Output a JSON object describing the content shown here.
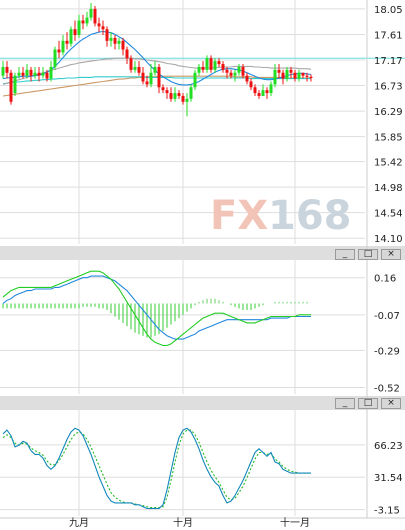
{
  "watermark": "FX168",
  "colors": {
    "up_candle": "#22dd22",
    "down_candle": "#ee1111",
    "ma_blue": "#2288dd",
    "ma_gray": "#a8a8a8",
    "ma_brown": "#cc9966",
    "ma_cyan": "#33cccc",
    "ref_line": "#66dddd",
    "macd_dif": "#22cc22",
    "macd_dea": "#2288dd",
    "kdj_k": "#1188bb",
    "kdj_d": "#22bb22",
    "grid": "#dddddd",
    "panel_bar": "#dedede",
    "watermark_fx": "#f2c4b8",
    "watermark_168": "#c9d4dd"
  },
  "panel_controls": {
    "minimize_icon": "_",
    "restore_icon": "□",
    "close_icon": "×"
  },
  "chart_data": [
    {
      "type": "candlestick",
      "title": "",
      "ylim": [
        14.0,
        18.1
      ],
      "yticks": [
        "18.05",
        "17.61",
        "17.17",
        "16.73",
        "16.29",
        "15.85",
        "15.42",
        "14.98",
        "14.54",
        "14.10"
      ],
      "reference_line": 17.2,
      "xticks": [
        {
          "index": 19,
          "label": "九月"
        },
        {
          "index": 45,
          "label": "十月"
        },
        {
          "index": 73,
          "label": "十一月"
        }
      ],
      "candles": [
        [
          16.9,
          17.05,
          17.15,
          16.85
        ],
        [
          17.05,
          16.95,
          17.15,
          16.85
        ],
        [
          16.95,
          16.45,
          17.0,
          16.4
        ],
        [
          16.6,
          16.9,
          16.95,
          16.55
        ],
        [
          16.9,
          16.95,
          17.05,
          16.85
        ],
        [
          16.95,
          16.9,
          17.05,
          16.85
        ],
        [
          16.9,
          17.0,
          17.1,
          16.85
        ],
        [
          17.0,
          16.9,
          17.05,
          16.8
        ],
        [
          16.9,
          16.95,
          17.05,
          16.85
        ],
        [
          16.95,
          16.9,
          17.05,
          16.8
        ],
        [
          16.9,
          16.95,
          17.05,
          16.85
        ],
        [
          16.95,
          16.85,
          17.0,
          16.8
        ],
        [
          16.85,
          17.05,
          17.15,
          16.8
        ],
        [
          17.05,
          17.35,
          17.4,
          17.0
        ],
        [
          17.35,
          17.3,
          17.5,
          17.2
        ],
        [
          17.3,
          17.5,
          17.6,
          17.25
        ],
        [
          17.5,
          17.45,
          17.65,
          17.35
        ],
        [
          17.45,
          17.7,
          17.75,
          17.4
        ],
        [
          17.7,
          17.6,
          17.85,
          17.5
        ],
        [
          17.6,
          17.85,
          17.95,
          17.55
        ],
        [
          17.85,
          17.8,
          17.95,
          17.7
        ],
        [
          17.8,
          17.9,
          18.0,
          17.75
        ],
        [
          17.9,
          18.05,
          18.15,
          17.85
        ],
        [
          18.05,
          17.8,
          18.1,
          17.75
        ],
        [
          17.8,
          17.75,
          17.9,
          17.65
        ],
        [
          17.75,
          17.7,
          17.85,
          17.6
        ],
        [
          17.7,
          17.5,
          17.75,
          17.4
        ],
        [
          17.5,
          17.55,
          17.65,
          17.4
        ],
        [
          17.55,
          17.45,
          17.6,
          17.35
        ],
        [
          17.45,
          17.5,
          17.55,
          17.35
        ],
        [
          17.5,
          17.35,
          17.55,
          17.25
        ],
        [
          17.35,
          17.2,
          17.4,
          17.1
        ],
        [
          17.2,
          17.0,
          17.25,
          16.95
        ],
        [
          17.0,
          17.05,
          17.15,
          16.95
        ],
        [
          17.05,
          16.95,
          17.15,
          16.9
        ],
        [
          16.95,
          16.8,
          17.05,
          16.75
        ],
        [
          16.8,
          16.75,
          16.9,
          16.7
        ],
        [
          16.75,
          16.95,
          17.1,
          16.7
        ],
        [
          16.95,
          17.05,
          17.15,
          16.9
        ],
        [
          17.05,
          16.7,
          17.1,
          16.6
        ],
        [
          16.7,
          16.65,
          16.75,
          16.6
        ],
        [
          16.65,
          16.6,
          16.7,
          16.5
        ],
        [
          16.6,
          16.5,
          16.7,
          16.45
        ],
        [
          16.5,
          16.6,
          16.7,
          16.45
        ],
        [
          16.6,
          16.55,
          16.65,
          16.5
        ],
        [
          16.55,
          16.45,
          16.6,
          16.4
        ],
        [
          16.45,
          16.5,
          16.6,
          16.2
        ],
        [
          16.5,
          16.7,
          16.75,
          16.45
        ],
        [
          16.7,
          16.95,
          17.0,
          16.65
        ],
        [
          16.95,
          17.05,
          17.1,
          16.9
        ],
        [
          17.05,
          17.0,
          17.15,
          16.95
        ],
        [
          17.0,
          17.2,
          17.25,
          16.95
        ],
        [
          17.2,
          17.0,
          17.25,
          16.95
        ],
        [
          17.0,
          17.15,
          17.2,
          16.95
        ],
        [
          17.15,
          17.1,
          17.2,
          17.05
        ],
        [
          17.1,
          17.0,
          17.15,
          16.95
        ],
        [
          17.0,
          16.95,
          17.05,
          16.85
        ],
        [
          16.95,
          16.9,
          17.0,
          16.85
        ],
        [
          16.9,
          16.95,
          17.0,
          16.8
        ],
        [
          16.95,
          17.05,
          17.1,
          16.9
        ],
        [
          17.05,
          16.9,
          17.1,
          16.85
        ],
        [
          16.9,
          16.8,
          16.95,
          16.75
        ],
        [
          16.8,
          16.7,
          16.85,
          16.65
        ],
        [
          16.7,
          16.6,
          16.75,
          16.55
        ],
        [
          16.6,
          16.55,
          16.65,
          16.5
        ],
        [
          16.55,
          16.65,
          16.75,
          16.55
        ],
        [
          16.65,
          16.6,
          16.7,
          16.5
        ],
        [
          16.6,
          16.75,
          16.8,
          16.55
        ],
        [
          16.75,
          17.0,
          17.1,
          16.7
        ],
        [
          17.0,
          16.95,
          17.1,
          16.85
        ],
        [
          16.95,
          16.85,
          17.0,
          16.75
        ],
        [
          16.85,
          17.0,
          17.05,
          16.8
        ],
        [
          17.0,
          16.95,
          17.05,
          16.85
        ],
        [
          16.95,
          16.85,
          17.0,
          16.8
        ],
        [
          16.85,
          16.95,
          17.0,
          16.8
        ],
        [
          16.95,
          16.9,
          16.95,
          16.85
        ],
        [
          16.9,
          16.88,
          16.95,
          16.8
        ],
        [
          16.88,
          16.86,
          16.92,
          16.8
        ]
      ],
      "ma_blue": [
        16.85,
        16.86,
        16.87,
        16.87,
        16.88,
        16.89,
        16.89,
        16.89,
        16.9,
        16.91,
        16.93,
        16.96,
        17.0,
        17.06,
        17.13,
        17.21,
        17.29,
        17.36,
        17.42,
        17.48,
        17.53,
        17.57,
        17.61,
        17.63,
        17.65,
        17.66,
        17.65,
        17.64,
        17.61,
        17.57,
        17.53,
        17.47,
        17.41,
        17.35,
        17.28,
        17.21,
        17.13,
        17.06,
        16.99,
        16.93,
        16.88,
        16.84,
        16.8,
        16.77,
        16.75,
        16.74,
        16.74,
        16.75,
        16.77,
        16.8,
        16.84,
        16.88,
        16.92,
        16.96,
        16.99,
        17.01,
        17.02,
        17.02,
        17.01,
        17.0,
        16.98,
        16.95,
        16.92,
        16.89,
        16.86,
        16.84,
        16.83,
        16.83,
        16.84,
        16.86,
        16.88,
        16.9,
        16.92,
        16.93,
        16.94,
        16.94,
        16.93,
        16.92
      ],
      "ma_gray": [
        16.75,
        16.77,
        16.79,
        16.81,
        16.83,
        16.85,
        16.87,
        16.89,
        16.91,
        16.93,
        16.95,
        16.97,
        16.99,
        17.01,
        17.03,
        17.05,
        17.07,
        17.09,
        17.1,
        17.12,
        17.13,
        17.14,
        17.15,
        17.16,
        17.17,
        17.18,
        17.19,
        17.19,
        17.2,
        17.2,
        17.2,
        17.2,
        17.2,
        17.19,
        17.19,
        17.18,
        17.17,
        17.16,
        17.15,
        17.14,
        17.13,
        17.11,
        17.1,
        17.09,
        17.07,
        17.06,
        17.05,
        17.04,
        17.03,
        17.03,
        17.03,
        17.03,
        17.03,
        17.04,
        17.04,
        17.05,
        17.05,
        17.05,
        17.06,
        17.06,
        17.06,
        17.06,
        17.06,
        17.05,
        17.05,
        17.04,
        17.04,
        17.03,
        17.03,
        17.03,
        17.03,
        17.03,
        17.03,
        17.03,
        17.02,
        17.02,
        17.02,
        17.01
      ],
      "ma_brown": [
        16.55,
        16.56,
        16.57,
        16.58,
        16.59,
        16.6,
        16.61,
        16.62,
        16.63,
        16.64,
        16.65,
        16.66,
        16.67,
        16.68,
        16.69,
        16.7,
        16.71,
        16.72,
        16.73,
        16.74,
        16.75,
        16.76,
        16.77,
        16.78,
        16.79,
        16.8,
        16.81,
        16.82,
        16.83,
        16.84,
        16.84,
        16.85,
        16.86,
        16.86,
        16.87,
        16.87,
        16.88,
        16.88,
        16.88,
        16.89,
        16.89,
        16.89,
        16.89,
        16.89,
        16.89,
        16.89,
        16.89,
        16.89,
        16.89,
        16.89,
        16.89,
        16.89,
        16.89,
        16.89,
        16.89,
        16.89,
        16.89,
        16.89,
        16.88,
        16.88,
        16.88,
        16.88,
        16.88,
        16.87,
        16.87,
        16.87,
        16.87,
        16.87,
        16.87,
        16.87,
        16.87,
        16.86,
        16.86,
        16.86,
        16.86,
        16.86,
        16.86,
        16.86
      ],
      "ma_cyan": [
        16.76,
        16.77,
        16.78,
        16.79,
        16.79,
        16.8,
        16.81,
        16.81,
        16.82,
        16.82,
        16.83,
        16.83,
        16.84,
        16.84,
        16.85,
        16.85,
        16.86,
        16.86,
        16.86,
        16.87,
        16.87,
        16.87,
        16.87,
        16.88,
        16.88,
        16.88,
        16.88,
        16.88,
        16.88,
        16.88,
        16.88,
        16.88,
        16.88,
        16.88,
        16.88,
        16.88,
        16.87,
        16.87,
        16.87,
        16.87,
        16.87,
        16.87,
        16.87,
        16.86,
        16.86,
        16.86,
        16.86,
        16.86,
        16.86,
        16.86,
        16.86,
        16.86,
        16.86,
        16.86,
        16.86,
        16.86,
        16.86,
        16.86,
        16.86,
        16.86,
        16.86,
        16.86,
        16.85,
        16.85,
        16.85,
        16.85,
        16.85,
        16.85,
        16.85,
        16.85,
        16.85,
        16.85,
        16.85,
        16.85,
        16.85,
        16.85,
        16.85,
        16.85
      ]
    },
    {
      "type": "macd",
      "ylim": [
        -0.56,
        0.22
      ],
      "yticks": [
        "0.16",
        "-0.07",
        "-0.29",
        "-0.52"
      ],
      "dif": [
        0.04,
        0.06,
        0.08,
        0.09,
        0.1,
        0.1,
        0.1,
        0.1,
        0.1,
        0.1,
        0.1,
        0.1,
        0.1,
        0.11,
        0.12,
        0.13,
        0.14,
        0.15,
        0.16,
        0.17,
        0.18,
        0.19,
        0.2,
        0.2,
        0.2,
        0.19,
        0.17,
        0.15,
        0.12,
        0.09,
        0.05,
        0.01,
        -0.03,
        -0.07,
        -0.11,
        -0.15,
        -0.19,
        -0.22,
        -0.24,
        -0.25,
        -0.26,
        -0.26,
        -0.25,
        -0.23,
        -0.21,
        -0.19,
        -0.17,
        -0.15,
        -0.13,
        -0.11,
        -0.09,
        -0.08,
        -0.07,
        -0.06,
        -0.06,
        -0.06,
        -0.07,
        -0.08,
        -0.09,
        -0.1,
        -0.11,
        -0.12,
        -0.12,
        -0.12,
        -0.11,
        -0.1,
        -0.09,
        -0.08,
        -0.08,
        -0.08,
        -0.08,
        -0.08,
        -0.08,
        -0.08,
        -0.07,
        -0.07,
        -0.07,
        -0.07
      ],
      "dea": [
        0.0,
        0.02,
        0.03,
        0.05,
        0.06,
        0.07,
        0.08,
        0.08,
        0.09,
        0.09,
        0.09,
        0.09,
        0.09,
        0.1,
        0.1,
        0.11,
        0.12,
        0.13,
        0.14,
        0.15,
        0.16,
        0.16,
        0.17,
        0.17,
        0.17,
        0.17,
        0.16,
        0.15,
        0.14,
        0.12,
        0.1,
        0.08,
        0.05,
        0.02,
        -0.01,
        -0.04,
        -0.07,
        -0.1,
        -0.13,
        -0.16,
        -0.18,
        -0.2,
        -0.21,
        -0.22,
        -0.22,
        -0.22,
        -0.21,
        -0.2,
        -0.19,
        -0.17,
        -0.16,
        -0.15,
        -0.14,
        -0.13,
        -0.12,
        -0.11,
        -0.1,
        -0.1,
        -0.1,
        -0.1,
        -0.1,
        -0.1,
        -0.1,
        -0.1,
        -0.1,
        -0.1,
        -0.1,
        -0.09,
        -0.09,
        -0.09,
        -0.09,
        -0.09,
        -0.08,
        -0.08,
        -0.08,
        -0.08,
        -0.08,
        -0.08
      ],
      "hist": [
        -0.03,
        -0.03,
        -0.03,
        -0.03,
        -0.03,
        -0.03,
        -0.03,
        -0.03,
        -0.03,
        -0.03,
        -0.03,
        -0.03,
        -0.03,
        -0.03,
        -0.03,
        -0.03,
        -0.03,
        -0.03,
        -0.03,
        -0.03,
        -0.02,
        -0.02,
        -0.02,
        -0.02,
        -0.03,
        -0.03,
        -0.04,
        -0.06,
        -0.08,
        -0.1,
        -0.12,
        -0.14,
        -0.16,
        -0.18,
        -0.19,
        -0.2,
        -0.21,
        -0.21,
        -0.2,
        -0.19,
        -0.17,
        -0.15,
        -0.13,
        -0.11,
        -0.09,
        -0.07,
        -0.05,
        -0.03,
        -0.01,
        0.01,
        0.02,
        0.03,
        0.03,
        0.03,
        0.02,
        0.01,
        0.0,
        -0.01,
        -0.02,
        -0.03,
        -0.04,
        -0.04,
        -0.04,
        -0.03,
        -0.02,
        -0.01,
        0.0,
        0.0,
        0.01,
        0.01,
        0.01,
        0.01,
        0.01,
        0.01,
        0.01,
        0.01,
        0.01,
        0.0
      ]
    },
    {
      "type": "kdj",
      "ylim": [
        -10,
        95
      ],
      "yticks": [
        "66.23",
        "31.54",
        "-3.15"
      ],
      "k": [
        78,
        82,
        76,
        64,
        66,
        70,
        68,
        60,
        56,
        56,
        52,
        44,
        40,
        44,
        52,
        62,
        72,
        80,
        84,
        82,
        76,
        66,
        56,
        44,
        32,
        22,
        12,
        6,
        4,
        4,
        4,
        4,
        4,
        2,
        2,
        0,
        -2,
        -2,
        -2,
        -2,
        2,
        18,
        38,
        58,
        74,
        82,
        84,
        80,
        72,
        62,
        50,
        40,
        32,
        26,
        22,
        12,
        4,
        6,
        12,
        20,
        28,
        38,
        48,
        58,
        62,
        58,
        54,
        58,
        48,
        46,
        40,
        38,
        36,
        36,
        36,
        36,
        36,
        36
      ],
      "d": [
        74,
        77,
        74,
        68,
        66,
        68,
        67,
        63,
        60,
        58,
        55,
        49,
        45,
        45,
        49,
        56,
        64,
        72,
        78,
        80,
        78,
        72,
        64,
        54,
        44,
        34,
        24,
        15,
        10,
        7,
        5,
        4,
        4,
        3,
        2,
        1,
        0,
        -1,
        -1,
        -1,
        0,
        10,
        28,
        48,
        66,
        78,
        82,
        82,
        77,
        69,
        58,
        48,
        39,
        32,
        26,
        18,
        10,
        7,
        9,
        15,
        22,
        31,
        41,
        51,
        58,
        58,
        56,
        57,
        51,
        48,
        43,
        40,
        38,
        37,
        36,
        36,
        36,
        36
      ]
    }
  ]
}
